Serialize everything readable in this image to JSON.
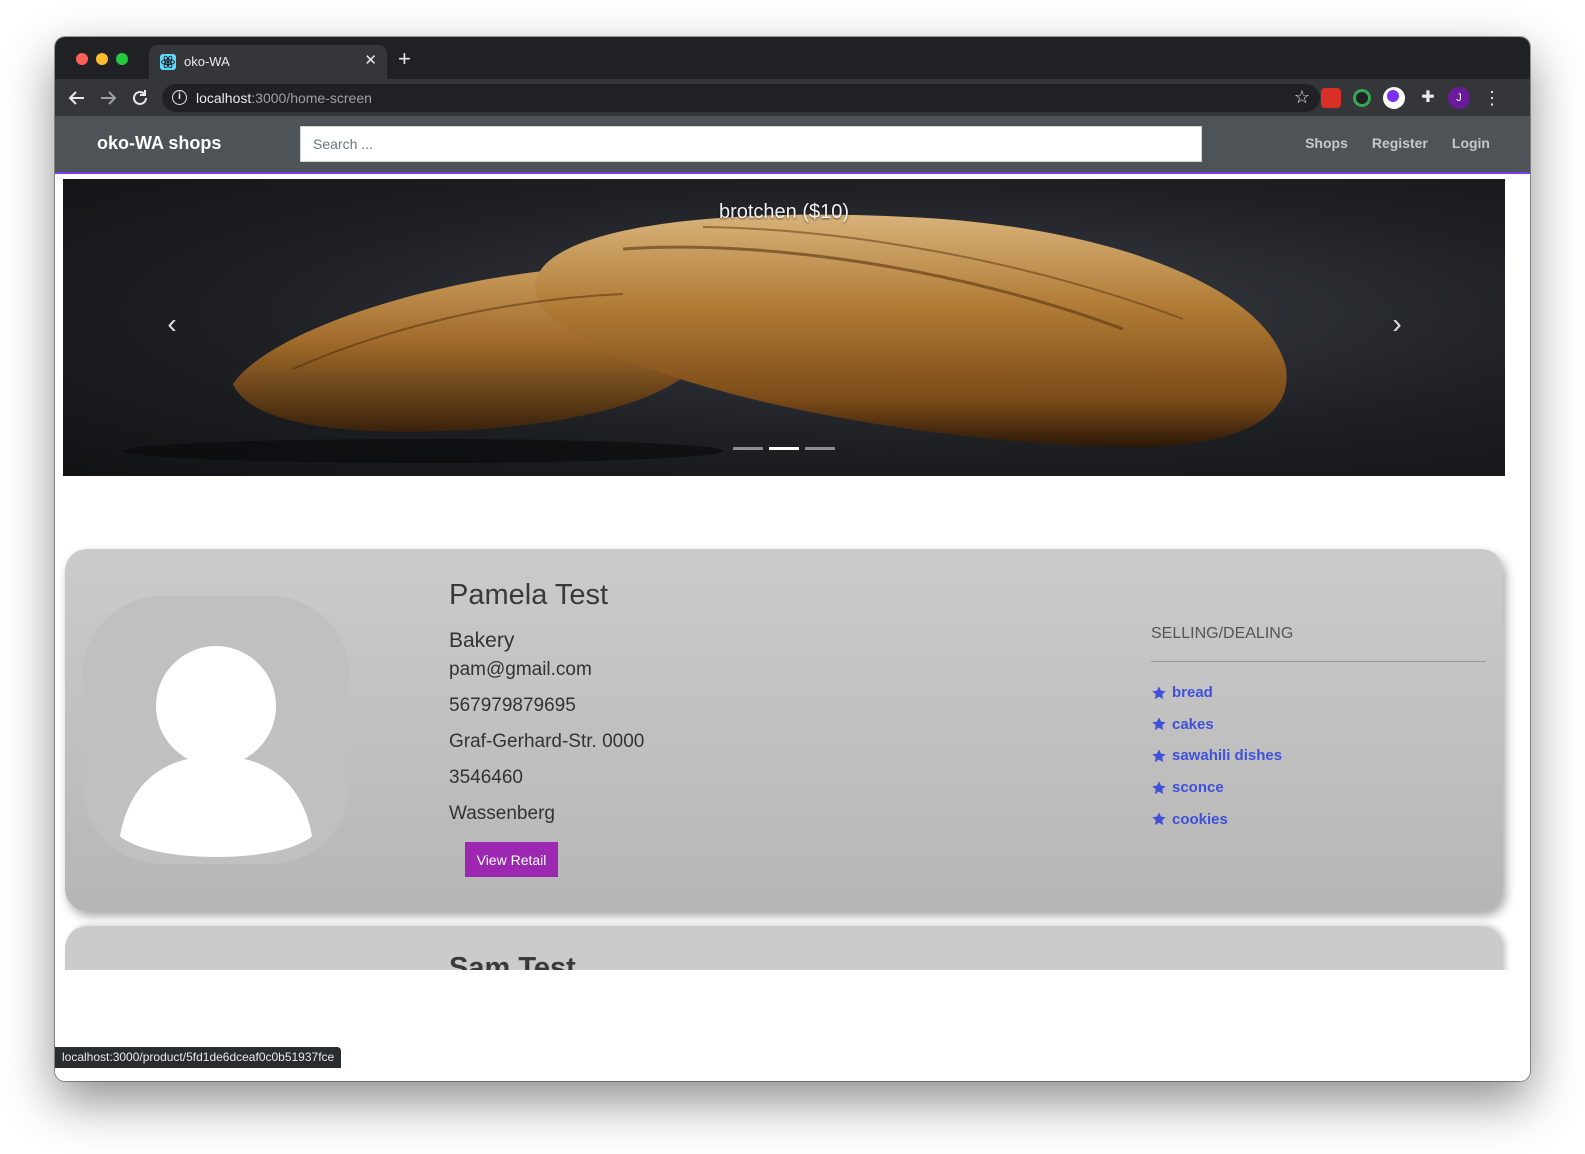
{
  "browser": {
    "tab_title": "oko-WA",
    "tab_close": "✕",
    "new_tab": "+",
    "url_host": "localhost",
    "url_path": ":3000/home-screen",
    "status_url": "localhost:3000/product/5fd1de6dceaf0c0b51937fce",
    "avatar_letter": "J"
  },
  "navbar": {
    "brand": "oko-WA shops",
    "search_placeholder": "Search ...",
    "links": [
      "Shops",
      "Register",
      "Login"
    ]
  },
  "carousel": {
    "caption": "brotchen ($10)",
    "slide_count": 3,
    "active_index": 1
  },
  "shops": [
    {
      "name": "Pamela Test",
      "category": "Bakery",
      "email": "pam@gmail.com",
      "phone": "567979879695",
      "street": "Graf-Gerhard-Str. 0000",
      "postcode": "3546460",
      "city": "Wassenberg",
      "button_label": "View Retail",
      "selling_heading": "SELLING/DEALING",
      "items": [
        "bread",
        "cakes",
        "sawahili dishes",
        "sconce",
        "cookies"
      ]
    },
    {
      "name": "Sam Test"
    }
  ],
  "colors": {
    "navbar_bg": "#4e5357",
    "accent_purple": "#9c27b0",
    "item_blue": "#3f51d9",
    "card_bg": "#c4c4c4"
  }
}
